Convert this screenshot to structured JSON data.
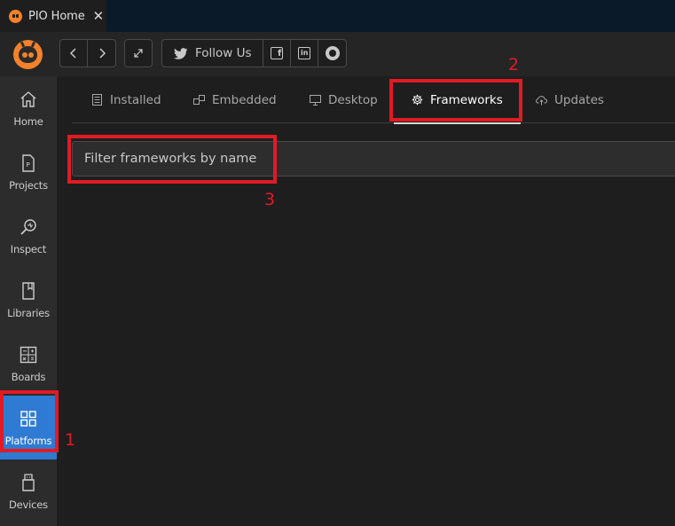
{
  "editor_tab": {
    "title": "PIO Home",
    "close": "✕"
  },
  "toolbar": {
    "back": "‹",
    "forward": "›",
    "follow_label": "Follow Us",
    "social_icons": [
      "twitter-icon",
      "facebook-icon",
      "linkedin-icon",
      "github-icon"
    ]
  },
  "sidebar": {
    "items": [
      {
        "label": "Home",
        "icon": "home-icon"
      },
      {
        "label": "Projects",
        "icon": "project-file-icon"
      },
      {
        "label": "Inspect",
        "icon": "inspect-icon"
      },
      {
        "label": "Libraries",
        "icon": "book-icon"
      },
      {
        "label": "Boards",
        "icon": "calculator-icon"
      },
      {
        "label": "Platforms",
        "icon": "grid-icon",
        "active": true
      },
      {
        "label": "Devices",
        "icon": "usb-icon"
      }
    ]
  },
  "platform_tabs": [
    {
      "label": "Installed",
      "icon": "list-icon"
    },
    {
      "label": "Embedded",
      "icon": "chip-icon"
    },
    {
      "label": "Desktop",
      "icon": "monitor-icon"
    },
    {
      "label": "Frameworks",
      "icon": "gear-icon",
      "active": true
    },
    {
      "label": "Updates",
      "icon": "cloud-upload-icon"
    }
  ],
  "filter": {
    "placeholder": "Filter frameworks by name",
    "value": ""
  },
  "annotations": [
    "1",
    "2",
    "3"
  ],
  "colors": {
    "active_sidebar": "#2f7ad3",
    "annotation": "#e01b24",
    "brand": "#f5822a"
  }
}
